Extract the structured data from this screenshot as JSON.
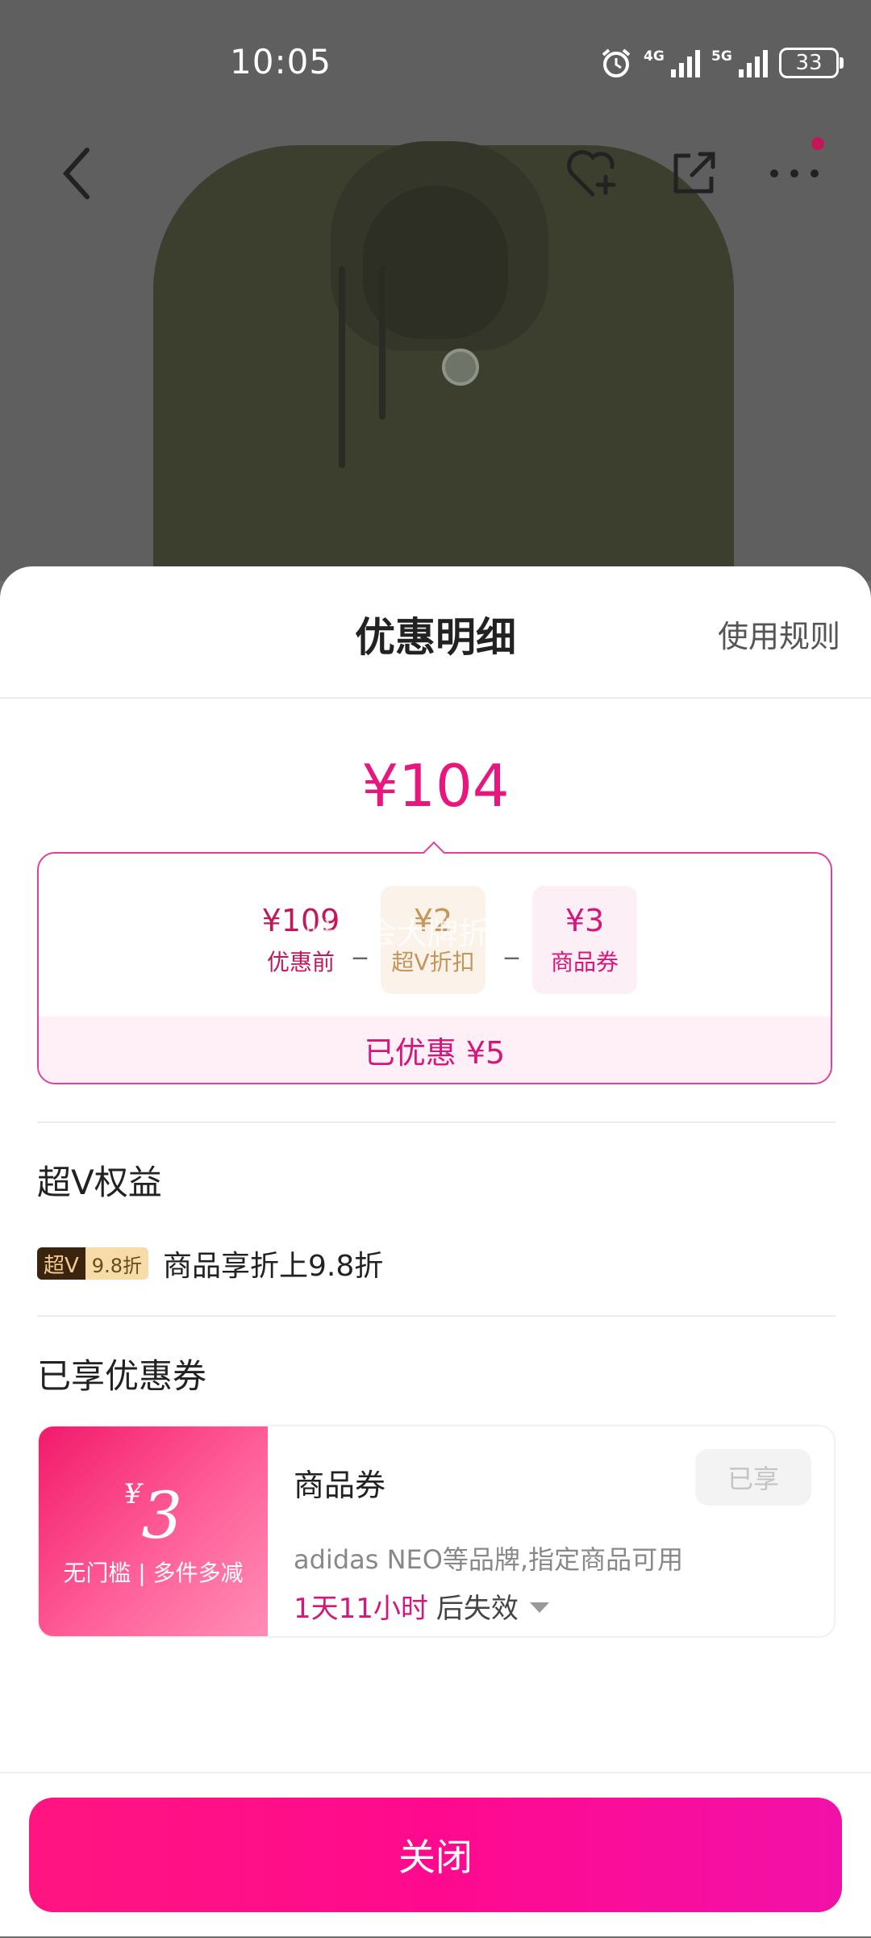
{
  "status_bar": {
    "time": "10:05",
    "network_1": "4G",
    "network_2": "5G",
    "battery": "33"
  },
  "sheet": {
    "title": "优惠明细",
    "rules_link": "使用规则",
    "final_price": "¥104",
    "breakdown": {
      "before": {
        "value": "¥109",
        "label": "优惠前"
      },
      "vip": {
        "value": "¥2",
        "label": "超V折扣"
      },
      "coupon": {
        "value": "¥3",
        "label": "商品券"
      },
      "op1": "_",
      "op2": "_",
      "overlay_text": "唯品会大牌折扣",
      "saved": "已优惠 ¥5"
    },
    "vip_section": {
      "title": "超V权益",
      "badge_main": "超V",
      "badge_discount": "9.8折",
      "text": "商品享折上9.8折"
    },
    "coupon_section": {
      "title": "已享优惠券",
      "coupon": {
        "currency": "¥",
        "amount": "3",
        "condition": "无门槛 | 多件多减",
        "name": "商品券",
        "status": "已享",
        "description": "adidas NEO等品牌,指定商品可用",
        "expiry_time": "1天11小时",
        "expiry_suffix": "后失效"
      }
    },
    "close_button": "关闭"
  },
  "colors": {
    "accent": "#e8177d",
    "vip_gold": "#c6955a"
  },
  "icons": [
    "back-icon",
    "favorite-add-icon",
    "share-icon",
    "more-icon",
    "alarm-icon",
    "caret-down-icon"
  ]
}
